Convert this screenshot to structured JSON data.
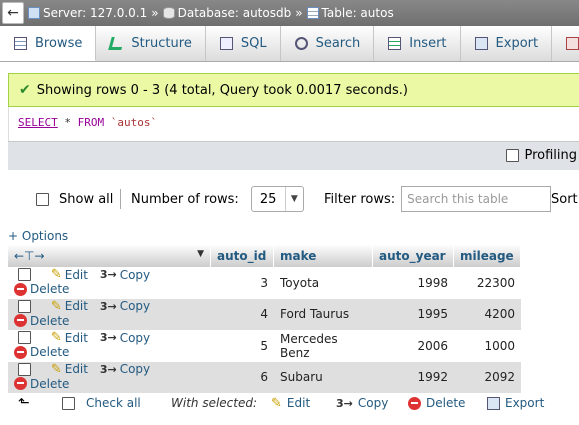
{
  "breadcrumb": {
    "server": "Server: 127.0.0.1",
    "database": "Database: autosdb",
    "table": "Table: autos",
    "separator": "»"
  },
  "tabs": [
    {
      "label": "Browse",
      "icon": "browse-icon",
      "active": true
    },
    {
      "label": "Structure",
      "icon": "structure-icon"
    },
    {
      "label": "SQL",
      "icon": "sql-icon"
    },
    {
      "label": "Search",
      "icon": "search-icon"
    },
    {
      "label": "Insert",
      "icon": "insert-icon"
    },
    {
      "label": "Export",
      "icon": "export-icon"
    }
  ],
  "message": {
    "text": "Showing rows 0 - 3 (4 total, Query took 0.0017 seconds.)"
  },
  "sql": {
    "select": "SELECT",
    "star": " * ",
    "from": "FROM",
    "table": " `autos`"
  },
  "profiling_label": "Profiling",
  "nav": {
    "show_all": "Show all",
    "number_of_rows_label": "Number of rows:",
    "rows_value": "25",
    "filter_label": "Filter rows:",
    "filter_placeholder": "Search this table",
    "sort_label": "Sort"
  },
  "options_label": "+ Options",
  "columns": [
    "auto_id",
    "make",
    "auto_year",
    "mileage"
  ],
  "row_actions": {
    "edit": "Edit",
    "copy": "Copy",
    "delete": "Delete"
  },
  "rows": [
    {
      "auto_id": "3",
      "make": "Toyota",
      "auto_year": "1998",
      "mileage": "22300"
    },
    {
      "auto_id": "4",
      "make": "Ford Taurus",
      "auto_year": "1995",
      "mileage": "4200"
    },
    {
      "auto_id": "5",
      "make": "Mercedes Benz",
      "auto_year": "2006",
      "mileage": "1000"
    },
    {
      "auto_id": "6",
      "make": "Subaru",
      "auto_year": "1992",
      "mileage": "2092"
    }
  ],
  "bottom": {
    "check_all": "Check all",
    "with_selected": "With selected:",
    "edit": "Edit",
    "copy": "Copy",
    "delete": "Delete",
    "export": "Export"
  },
  "colors": {
    "link": "#235a81",
    "success_bg": "#ebf8a4",
    "row_alt": "#dfdfdf"
  }
}
